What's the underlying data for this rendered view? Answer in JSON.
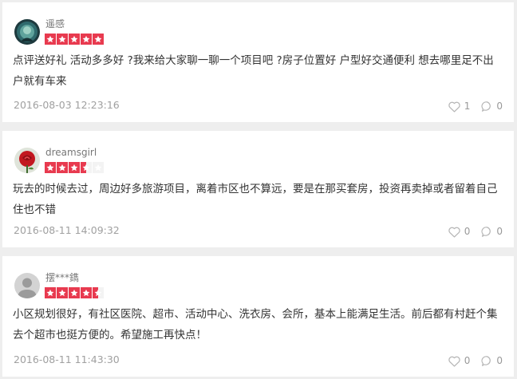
{
  "reviews": [
    {
      "username": "遥感",
      "avatar": "portrait-avatar",
      "rating": 5,
      "content": "点评送好礼 活动多多好 ?我来给大家聊一聊一个项目吧 ?房子位置好 户型好交通便利 想去哪里足不出户就有车来",
      "date": "2016-08-03 12:23:16",
      "likes": "1",
      "comments": "0"
    },
    {
      "username": "dreamsgirl",
      "avatar": "rose-avatar",
      "rating": 3.5,
      "content": "玩去的时候去过，周边好多旅游项目，离着市区也不算远，要是在那买套房，投资再卖掉或者留着自己住也不错",
      "date": "2016-08-11 14:09:32",
      "likes": "0",
      "comments": "0"
    },
    {
      "username": "摆***鐫",
      "avatar": "default-user-avatar",
      "rating": 4.5,
      "content": "小区规划很好，有社区医院、超市、活动中心、洗衣房、会所，基本上能满足生活。前后都有村赶个集去个超市也挺方便的。希望施工再快点！",
      "date": "2016-08-11 11:43:30",
      "likes": "0",
      "comments": "0"
    }
  ],
  "icons": {
    "like": "heart-icon",
    "comment": "comment-bubble-icon",
    "star": "star-icon"
  },
  "colors": {
    "star": "#e83a4f",
    "star_empty": "#f3f3f3",
    "text": "#333333",
    "meta": "#a0a0a0"
  }
}
